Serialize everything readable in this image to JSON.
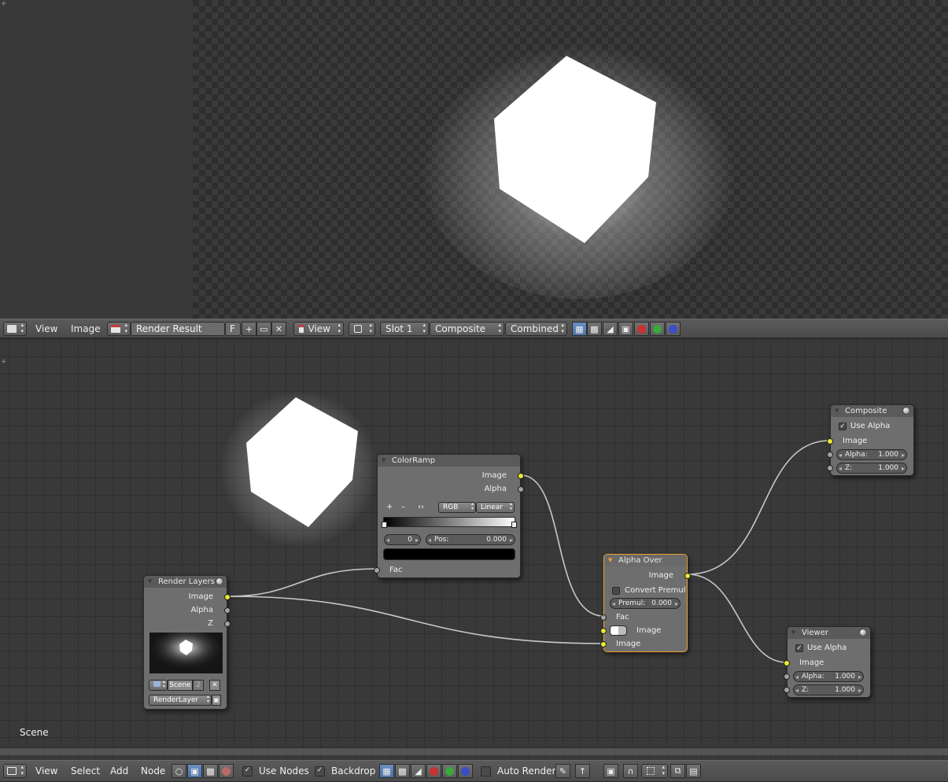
{
  "image_editor": {
    "header": {
      "editor_type_icon": "image-editor-icon",
      "menus": [
        "View",
        "Image"
      ],
      "image_browse_icon": "image-browse-icon",
      "image_name": "Render Result",
      "fake_user_label": "F",
      "new_image_icon": "plus-icon",
      "open_image_icon": "folder-icon",
      "unlink_icon": "close-icon",
      "mode_icon": "view-mode-icon",
      "mode_label": "View",
      "pivot_icon": "pivot-icon",
      "slot_label": "Slot 1",
      "layer_label": "Composite",
      "pass_label": "Combined",
      "display_channels": [
        "color-alpha-icon",
        "alpha-icon",
        "z-buffer-icon",
        "red-channel-icon",
        "green-channel-icon",
        "blue-channel-icon"
      ]
    }
  },
  "node_editor": {
    "backdrop_label": "Scene",
    "nodes": {
      "render_layers": {
        "title": "Render Layers",
        "outputs": [
          "Image",
          "Alpha",
          "Z"
        ],
        "scene_label": "Scene",
        "scene_users": "2",
        "layer_label": "RenderLayer"
      },
      "color_ramp": {
        "title": "ColorRamp",
        "outputs": [
          "Image",
          "Alpha"
        ],
        "add_label": "+",
        "remove_label": "–",
        "flip_label": "‹›",
        "color_mode": "RGB",
        "interpolation": "Linear",
        "active_index": "0",
        "pos_label": "Pos:",
        "pos_value": "0.000",
        "input": "Fac"
      },
      "alpha_over": {
        "title": "Alpha Over",
        "output": "Image",
        "convert_premul_label": "Convert Premul",
        "premul_label": "Premul:",
        "premul_value": "0.000",
        "inputs": [
          "Fac",
          "Image",
          "Image"
        ]
      },
      "composite": {
        "title": "Composite",
        "use_alpha_label": "Use Alpha",
        "input": "Image",
        "alpha_label": "Alpha:",
        "alpha_value": "1.000",
        "z_label": "Z:",
        "z_value": "1.000"
      },
      "viewer": {
        "title": "Viewer",
        "use_alpha_label": "Use Alpha",
        "input": "Image",
        "alpha_label": "Alpha:",
        "alpha_value": "1.000",
        "z_label": "Z:",
        "z_value": "1.000"
      }
    },
    "header": {
      "editor_type_icon": "node-editor-icon",
      "menus": [
        "View",
        "Select",
        "Add",
        "Node"
      ],
      "tree_type_icons": [
        "shader-nodes-icon",
        "compositing-nodes-icon",
        "texture-nodes-icon",
        "material-icon"
      ],
      "use_nodes_label": "Use Nodes",
      "backdrop_toggle_label": "Backdrop",
      "auto_render_label": "Auto Render",
      "colors": {
        "selected_outline": "#f0a030",
        "socket_image": "#e8e830",
        "socket_value": "#a2a2a2"
      }
    }
  }
}
